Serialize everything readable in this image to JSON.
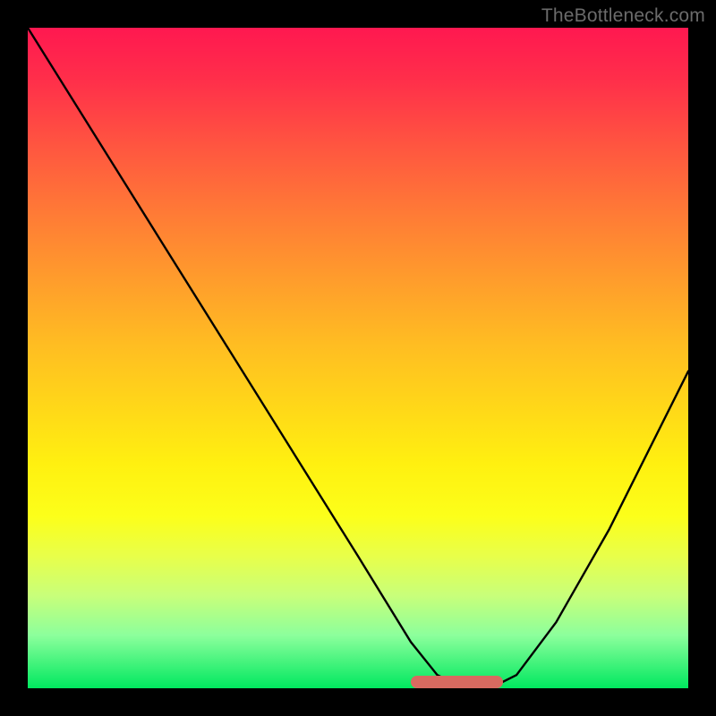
{
  "watermark": "TheBottleneck.com",
  "chart_data": {
    "type": "line",
    "title": "",
    "xlabel": "",
    "ylabel": "",
    "xlim": [
      0,
      100
    ],
    "ylim": [
      0,
      100
    ],
    "series": [
      {
        "name": "bottleneck-curve",
        "x": [
          0,
          10,
          20,
          30,
          40,
          50,
          58,
          62,
          66,
          70,
          74,
          80,
          88,
          100
        ],
        "y": [
          100,
          84,
          68,
          52,
          36,
          20,
          7,
          2,
          0,
          0,
          2,
          10,
          24,
          48
        ]
      }
    ],
    "marker": {
      "x_start": 58,
      "x_end": 72,
      "y": 0
    },
    "background_gradient": {
      "top": "#ff1850",
      "mid": "#ffe015",
      "bottom": "#00e85f"
    }
  }
}
